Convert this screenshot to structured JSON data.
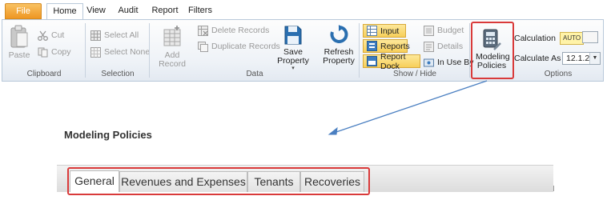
{
  "ribbon": {
    "tabs": [
      {
        "label": "File"
      },
      {
        "label": "Home",
        "active": true
      },
      {
        "label": "View"
      },
      {
        "label": "Audit"
      },
      {
        "label": "Report"
      },
      {
        "label": "Filters"
      }
    ],
    "groups": {
      "clipboard": {
        "label": "Clipboard",
        "paste": "Paste",
        "cut": "Cut",
        "copy": "Copy"
      },
      "selection": {
        "label": "Selection",
        "select_all": "Select All",
        "select_none": "Select None"
      },
      "data": {
        "label": "Data",
        "add_record": "Add Record",
        "delete_records": "Delete Records",
        "duplicate_records": "Duplicate Records",
        "save_property": "Save Property",
        "refresh_property": "Refresh Property"
      },
      "show_hide": {
        "label": "Show / Hide",
        "input": "Input",
        "reports": "Reports",
        "report_dock": "Report Dock",
        "budget": "Budget",
        "details": "Details",
        "in_use_by": "In Use By"
      },
      "modeling": {
        "label": "Modeling Policies"
      },
      "options": {
        "label": "Options",
        "calculation_label": "Calculation",
        "calculation_value": "AUTO",
        "calculate_as_label": "Calculate As",
        "calculate_as_value": "12.1.2"
      }
    }
  },
  "page": {
    "title": "Modeling Policies",
    "tabs": [
      {
        "label": "General",
        "active": true
      },
      {
        "label": "Revenues and Expenses"
      },
      {
        "label": "Tenants"
      },
      {
        "label": "Recoveries"
      }
    ]
  },
  "colors": {
    "highlight": "#d93a3a",
    "annotation_arrow": "#4a7fc1",
    "file_tab": "#ee9623"
  }
}
